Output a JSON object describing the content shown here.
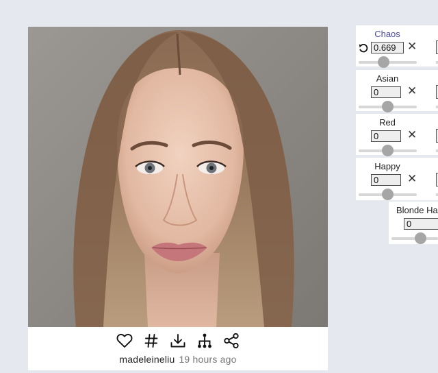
{
  "post": {
    "username": "madeleineliu",
    "time_ago": "19 hours ago",
    "actions": [
      {
        "name": "like",
        "icon": "heart-icon"
      },
      {
        "name": "tags",
        "icon": "hashtag-icon"
      },
      {
        "name": "download",
        "icon": "download-icon"
      },
      {
        "name": "family-tree",
        "icon": "tree-icon"
      },
      {
        "name": "share",
        "icon": "share-icon"
      }
    ]
  },
  "genes": [
    {
      "label": "Chaos",
      "value": "0.669",
      "active": true,
      "level": 0.45
    },
    {
      "label": "Asian",
      "value": "0",
      "active": false,
      "level": 0.5
    },
    {
      "label": "Red",
      "value": "0",
      "active": false,
      "level": 0.5
    },
    {
      "label": "Happy",
      "value": "0",
      "active": false,
      "level": 0.5
    },
    {
      "label": "Blonde Hair",
      "value": "0",
      "active": false,
      "level": 0.5
    }
  ],
  "colors": {
    "background": "#e6e8f0",
    "active_label": "#4a4aa0",
    "thumb": "#a6a6a6"
  }
}
